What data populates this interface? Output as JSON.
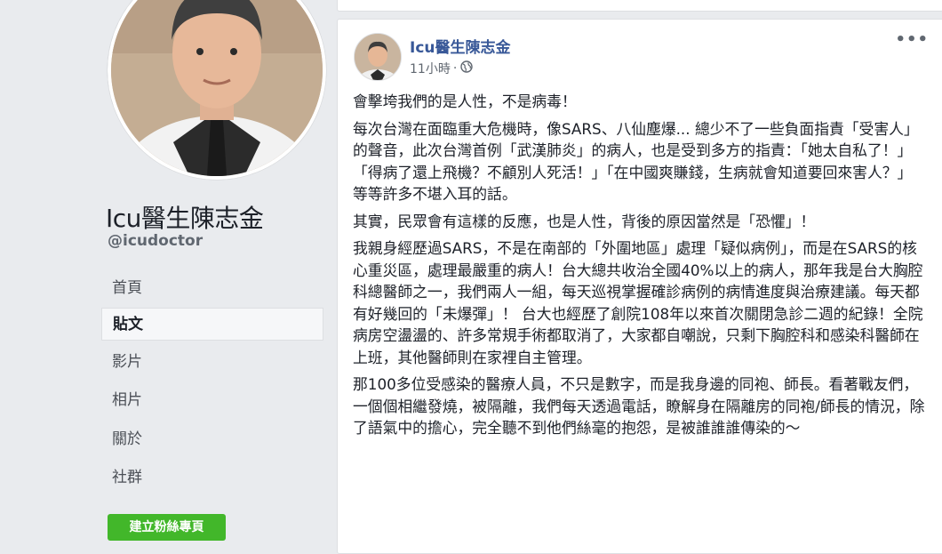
{
  "profile": {
    "name": "Icu醫生陳志金",
    "handle": "@icudoctor"
  },
  "nav": [
    {
      "label": "首頁"
    },
    {
      "label": "貼文"
    },
    {
      "label": "影片"
    },
    {
      "label": "相片"
    },
    {
      "label": "關於"
    },
    {
      "label": "社群"
    }
  ],
  "create_page_button": "建立粉絲專頁",
  "post": {
    "author": "Icu醫生陳志金",
    "time": "11小時",
    "separator": "·",
    "more": "•••",
    "paragraphs": [
      "會擊垮我們的是人性，不是病毒！",
      "每次台灣在面臨重大危機時，像SARS、八仙塵爆... 總少不了一些負面指責「受害人」的聲音，此次台灣首例「武漢肺炎」的病人，也是受到多方的指責：「她太自私了！」「得病了還上飛機？不顧別人死活！」「在中國爽賺錢，生病就會知道要回來害人？」等等許多不堪入耳的話。",
      "其實，民眾會有這樣的反應，也是人性，背後的原因當然是「恐懼」！",
      "我親身經歷過SARS，不是在南部的「外圍地區」處理「疑似病例」，而是在SARS的核心重災區，處理最嚴重的病人！台大總共收治全國40%以上的病人，那年我是台大胸腔科總醫師之一，我們兩人一組，每天巡視掌握確診病例的病情進度與治療建議。每天都有好幾回的「未爆彈」！ 台大也經歷了創院108年以來首次關閉急診二週的紀錄！全院病房空盪盪的、許多常規手術都取消了，大家都自嘲說，只剩下胸腔科和感染科醫師在上班，其他醫師則在家裡自主管理。",
      "那100多位受感染的醫療人員，不只是數字，而是我身邊的同袍、師長。看著戰友們，一個個相繼發燒，被隔離，我們每天透過電話，瞭解身在隔離房的同袍/師長的情況，除了語氣中的擔心，完全聽不到他們絲毫的抱怨，是被誰誰誰傳染的～"
    ]
  }
}
